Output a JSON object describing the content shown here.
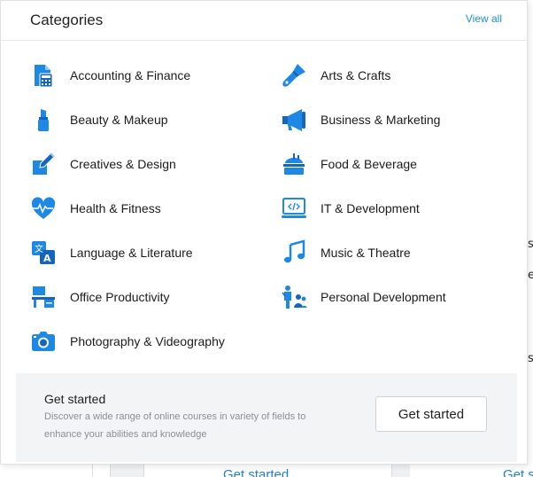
{
  "header": {
    "title": "Categories",
    "view_all": "View all"
  },
  "categories": [
    {
      "label": "Accounting & Finance",
      "icon": "calculator-icon"
    },
    {
      "label": "Arts & Crafts",
      "icon": "paintbrush-icon"
    },
    {
      "label": "Beauty & Makeup",
      "icon": "lipstick-icon"
    },
    {
      "label": "Business & Marketing",
      "icon": "megaphone-icon"
    },
    {
      "label": "Creatives & Design",
      "icon": "pen-design-icon"
    },
    {
      "label": "Food & Beverage",
      "icon": "food-icon"
    },
    {
      "label": "Health & Fitness",
      "icon": "heart-pulse-icon"
    },
    {
      "label": "IT & Development",
      "icon": "code-laptop-icon"
    },
    {
      "label": "Language & Literature",
      "icon": "translate-icon"
    },
    {
      "label": "Music & Theatre",
      "icon": "music-note-icon"
    },
    {
      "label": "Office Productivity",
      "icon": "office-desk-icon"
    },
    {
      "label": "Personal Development",
      "icon": "people-growth-icon"
    },
    {
      "label": "Photography & Videography",
      "icon": "camera-icon"
    }
  ],
  "footer": {
    "title": "Get started",
    "description": "Discover a wide range of online courses in variety of fields to enhance your abilities and knowledge",
    "button_label": "Get started"
  },
  "background": {
    "partial_link": "Get started",
    "right_glyphs": [
      "s",
      "e",
      "s"
    ]
  },
  "colors": {
    "accent": "#1f8fd6",
    "icon_blue": "#1e88e5",
    "footer_bg": "#f3f4f6"
  }
}
